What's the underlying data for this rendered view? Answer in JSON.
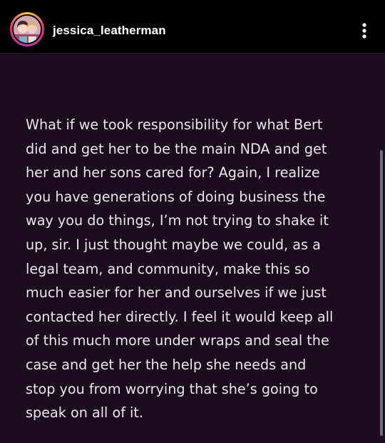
{
  "post": {
    "username": "jessica_leatherman",
    "more_icon": "vertical-ellipsis-icon",
    "avatar_icon": "profile-avatar-icon",
    "text": "What if we took responsibility for what Bert\ndid and get her to be the main NDA and get\nher and her sons cared for? Again, I realize\nyou have generations of doing business the\nway you do things, I’m not trying to shake it\nup, sir. I just thought maybe we could, as a\nlegal team, and community, make this so\nmuch easier for her and ourselves if we just\ncontacted her directly. I feel it would keep all\nof this much more under wraps and seal the\ncase and get her the help she needs and\nstop you from worrying that she’s going to\nspeak on all of it."
  },
  "colors": {
    "background": "#000000",
    "post_background": "#1d0c1d",
    "text": "#eae6ea"
  }
}
